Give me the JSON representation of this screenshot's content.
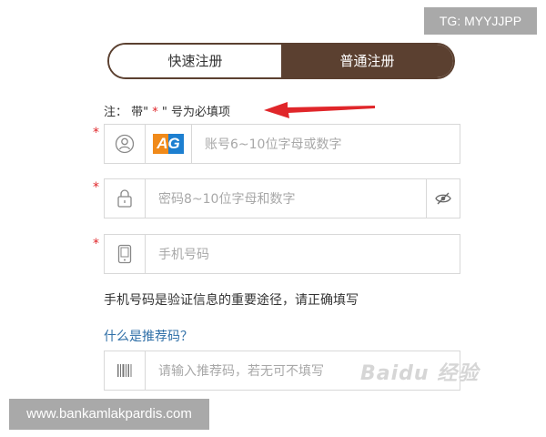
{
  "watermark_top": "TG: MYYJJPP",
  "watermark_bottom": "www.bankamlakpardis.com",
  "tabs": [
    {
      "label": "快速注册",
      "active": false
    },
    {
      "label": "普通注册",
      "active": true
    }
  ],
  "note": {
    "prefix": "注：  带\"",
    "star": " * ",
    "suffix": "\" 号为必填项"
  },
  "required_mark": "*",
  "fields": {
    "account": {
      "placeholder": "账号6~10位字母或数字",
      "badge": "AG",
      "icon": "user-icon"
    },
    "password": {
      "placeholder": "密码8~10位字母和数字",
      "icon": "lock-icon",
      "toggle_icon": "eye-hidden-icon"
    },
    "phone": {
      "placeholder": "手机号码",
      "icon": "phone-icon"
    },
    "referral": {
      "placeholder": "请输入推荐码，若无可不填写",
      "icon": "barcode-icon"
    }
  },
  "phone_hint": "手机号码是验证信息的重要途径，请正确填写",
  "referral_link": "什么是推荐码？",
  "baidu_watermark": "Baidu 经验",
  "colors": {
    "brand_brown": "#5b4030",
    "required_red": "#e0262a",
    "link_blue": "#2f6fa7"
  }
}
